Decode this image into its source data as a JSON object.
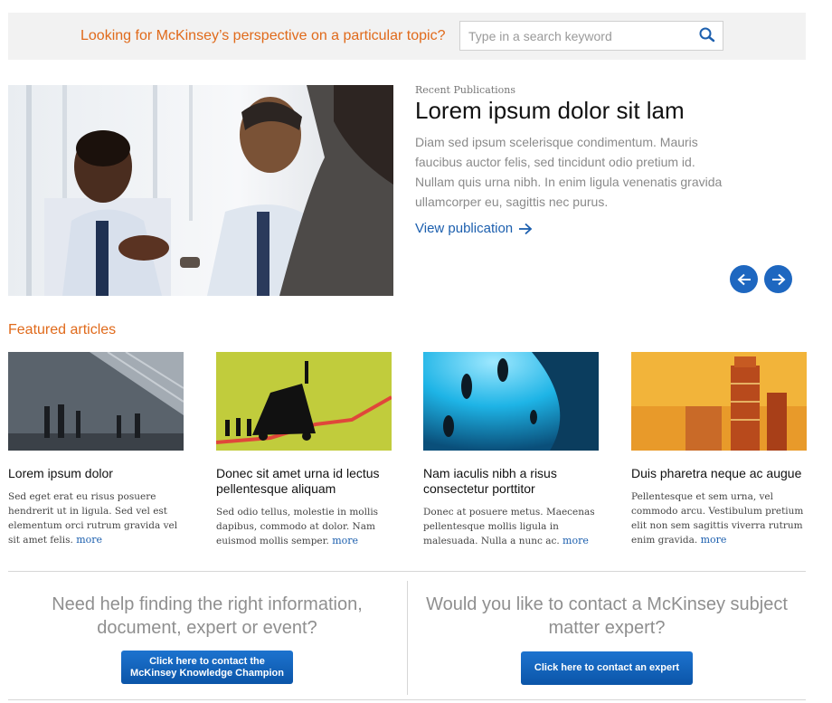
{
  "search": {
    "prompt": "Looking for McKinsey’s perspective on a particular topic?",
    "placeholder": "Type in a search keyword",
    "value": "",
    "icon": "search-icon"
  },
  "hero": {
    "kicker": "Recent Publications",
    "title": "Lorem ipsum dolor sit lam",
    "body": "Diam sed ipsum scelerisque condimentum. Mauris faucibus auctor felis, sed tincidunt odio pretium id. Nullam quis urna nibh. In enim ligula venenatis gravida ullamcorper eu, sagittis nec purus.",
    "link_label": "View publication",
    "link_icon": "arrow-right-icon",
    "prev_icon": "arrow-left-icon",
    "next_icon": "arrow-right-icon"
  },
  "featured": {
    "heading": "Featured articles",
    "more_label": "more",
    "articles": [
      {
        "title": "Lorem ipsum dolor",
        "excerpt": "Sed eget erat eu risus posuere hendrerit ut in ligula. Sed vel est elementum orci rutrum gravida vel sit amet felis."
      },
      {
        "title": "Donec sit amet urna id lectus pellentesque aliquam",
        "excerpt": "Sed odio tellus, molestie in mollis dapibus, commodo at dolor. Nam euismod mollis semper."
      },
      {
        "title": "Nam iaculis nibh a risus consectetur porttitor",
        "excerpt": "Donec at posuere metus. Maecenas pellentesque mollis ligula in malesuada. Nulla a nunc ac."
      },
      {
        "title": "Duis pharetra neque ac augue",
        "excerpt": "Pellentesque et sem urna, vel commodo arcu. Vestibulum pretium elit non sem sagittis viverra rutrum enim gravida."
      }
    ]
  },
  "help": {
    "left_text": "Need help finding the right information, document, expert or event?",
    "left_button_line1": "Click here to contact the",
    "left_button_line2": "McKinsey Knowledge Champion",
    "right_text": "Would you like to contact a McKinsey subject matter expert?",
    "right_button": "Click here to contact an expert"
  },
  "colors": {
    "accent_orange": "#e06a1b",
    "link_blue": "#1c5fae",
    "button_blue": "#1e67c0"
  }
}
